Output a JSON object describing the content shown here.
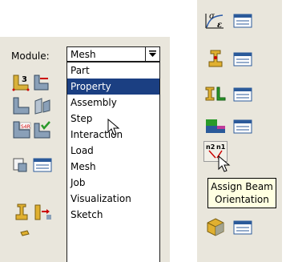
{
  "left_panel": {
    "module_label": "Module:",
    "module_select": {
      "value": "Mesh"
    },
    "dropdown_options": [
      "Part",
      "Property",
      "Assembly",
      "Step",
      "Interaction",
      "Load",
      "Mesh",
      "Job",
      "Visualization",
      "Sketch"
    ],
    "selected_option": "Property",
    "tool_badges": {
      "three": "3",
      "s4r": "S4R"
    }
  },
  "right_panel": {
    "tooltip_line1": "Assign Beam",
    "tooltip_line2": "Orientation",
    "section_icon_text": {
      "sigma": "σ",
      "epsilon": "ε"
    },
    "orientation_icon_text": {
      "n2": "n2",
      "n1": "n1",
      "t": "t"
    }
  },
  "colors": {
    "panel_bg": "#e9e6dc",
    "selection": "#1b3f82",
    "tooltip_bg": "#ffffe1"
  }
}
